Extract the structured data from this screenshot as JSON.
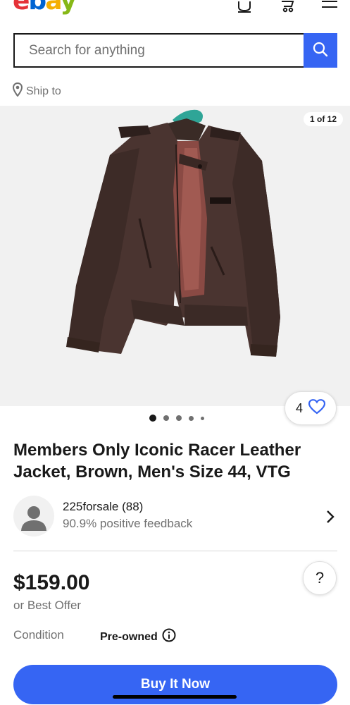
{
  "header": {
    "logo": [
      "e",
      "b",
      "a",
      "y"
    ],
    "icons": [
      "notifications-icon",
      "cart-icon",
      "menu-icon"
    ]
  },
  "search": {
    "placeholder": "Search for anything",
    "value": ""
  },
  "ship_to": {
    "label": "Ship to"
  },
  "gallery": {
    "counter": "1 of 12",
    "watch_count": "4",
    "dots": 5,
    "active_dot": 0
  },
  "listing": {
    "title": "Members Only Iconic Racer Leather Jacket, Brown, Men's Size 44, VTG"
  },
  "seller": {
    "name": "225forsale (88)",
    "feedback": "90.9% positive feedback"
  },
  "price": {
    "amount": "$159.00",
    "offer": "or Best Offer"
  },
  "help": {
    "label": "?"
  },
  "condition": {
    "label": "Condition",
    "value": "Pre-owned"
  },
  "actions": {
    "buy_now": "Buy It Now"
  },
  "colors": {
    "accent": "#3665f3",
    "text": "#191919",
    "muted": "#707070"
  }
}
